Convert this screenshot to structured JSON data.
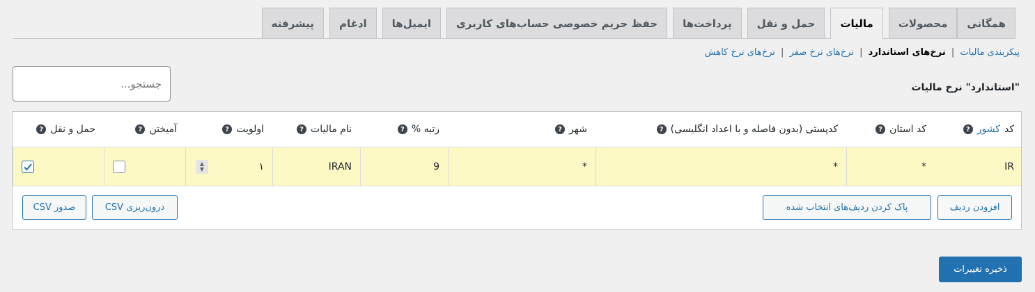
{
  "tabs": [
    {
      "label": "همگانی",
      "active": false
    },
    {
      "label": "محصولات",
      "active": false
    },
    {
      "label": "مالیات",
      "active": true
    },
    {
      "label": "حمل و نقل",
      "active": false
    },
    {
      "label": "پرداخت‌ها",
      "active": false
    },
    {
      "label": "حفظ حریم خصوصی حساب‌های کاربری",
      "active": false
    },
    {
      "label": "ایمیل‌ها",
      "active": false
    },
    {
      "label": "ادغام",
      "active": false
    },
    {
      "label": "پیشرفته",
      "active": false
    }
  ],
  "sublinks": {
    "tax_options": "پیکربندی مالیات",
    "standard_rates": "نرخ‌های استاندارد",
    "zero_rates": "نرخ‌های نرخ صفر",
    "reduced_rates": "نرخ‌های نرخ کاهش",
    "separator": "|"
  },
  "search": {
    "placeholder": "جستجو..."
  },
  "heading": "\"استاندارد\" نرخ مالیات",
  "table": {
    "headers": {
      "country_code_prefix": "کد",
      "country_code_link": "کشور",
      "state_code": "کد استان",
      "postcode": "کدپستی (بدون فاصله و با اعداد انگلیسی)",
      "city": "شهر",
      "rate": "رتبه %",
      "tax_name": "نام مالیات",
      "priority": "اولویت",
      "compound": "آمیختن",
      "shipping": "حمل و نقل"
    },
    "help_glyph": "?",
    "row": {
      "country": "IR",
      "state": "*",
      "postcode": "*",
      "city": "*",
      "rate": "9",
      "tax_name": "IRAN",
      "priority": "۱",
      "compound": false,
      "shipping": true
    }
  },
  "buttons": {
    "insert_row": "افزودن ردیف",
    "remove_selected": "پاک کردن ردیف‌های انتخاب شده",
    "import_csv": "درون‌ریزی CSV",
    "export_csv": "صدور CSV",
    "save": "ذخیره تغییرات"
  },
  "colors": {
    "accent": "#2271b1",
    "row_highlight": "#fcf9c4"
  }
}
